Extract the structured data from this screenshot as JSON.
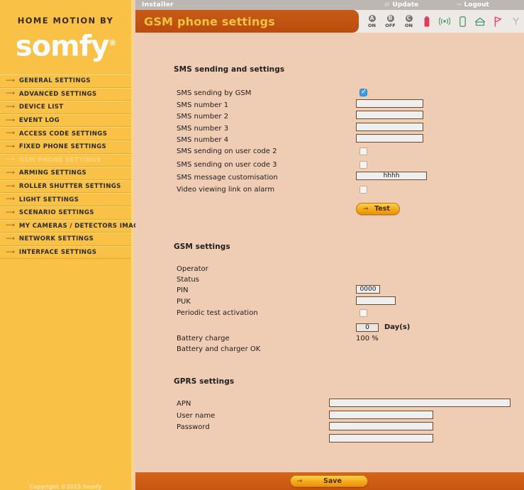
{
  "brand": {
    "tagline": "HOME MOTION BY",
    "name": "somfy",
    "registered": "®",
    "copyright": "Copyright ©2013 Somfy"
  },
  "topbar": {
    "user_role": "Installer",
    "update_label": "Update",
    "update_icon": "refresh-icon",
    "logout_label": "Logout",
    "logout_icon": "arrow-right-icon"
  },
  "header": {
    "page_title": "GSM phone settings",
    "status_groups": [
      {
        "letter": "A",
        "state": "ON"
      },
      {
        "letter": "B",
        "state": "OFF"
      },
      {
        "letter": "C",
        "state": "ON"
      }
    ],
    "status_icons": [
      {
        "name": "battery-icon",
        "color": "#E03A5C"
      },
      {
        "name": "radio-signal-icon",
        "color": "#4E9B6B"
      },
      {
        "name": "mobile-phone-icon",
        "color": "#4E9B6B"
      },
      {
        "name": "home-icon",
        "color": "#4E9B6B"
      },
      {
        "name": "flag-icon",
        "color": "#E8497A"
      },
      {
        "name": "antenna-icon",
        "color": "#B7AFA9"
      },
      {
        "name": "document-icon",
        "color": "#9A938E"
      }
    ]
  },
  "sidebar": {
    "items": [
      {
        "label": "GENERAL SETTINGS",
        "active": false
      },
      {
        "label": "ADVANCED SETTINGS",
        "active": false
      },
      {
        "label": "DEVICE LIST",
        "active": false
      },
      {
        "label": "EVENT LOG",
        "active": false
      },
      {
        "label": "ACCESS CODE SETTINGS",
        "active": false
      },
      {
        "label": "FIXED PHONE SETTINGS",
        "active": false
      },
      {
        "label": "GSM PHONE SETTINGS",
        "active": true
      },
      {
        "label": "ARMING SETTINGS",
        "active": false
      },
      {
        "label": "ROLLER SHUTTER SETTINGS",
        "active": false
      },
      {
        "label": "LIGHT SETTINGS",
        "active": false
      },
      {
        "label": "SCENARIO SETTINGS",
        "active": false
      },
      {
        "label": "MY CAMERAS / DETECTORS IMAGES",
        "active": false
      },
      {
        "label": "NETWORK SETTINGS",
        "active": false
      },
      {
        "label": "INTERFACE SETTINGS",
        "active": false
      }
    ]
  },
  "sms_section": {
    "title": "SMS sending and settings",
    "sending_by_gsm_label": "SMS sending by GSM",
    "sending_by_gsm_checked": true,
    "number1_label": "SMS number 1",
    "number1_value": "",
    "number2_label": "SMS number 2",
    "number2_value": "",
    "number3_label": "SMS number 3",
    "number3_value": "",
    "number4_label": "SMS number 4",
    "number4_value": "",
    "usercode2_label": "SMS sending on user code 2",
    "usercode2_checked": false,
    "usercode3_label": "SMS sending on user code 3",
    "usercode3_checked": false,
    "message_custom_label": "SMS message customisation",
    "message_custom_value": "hhhh",
    "video_link_label": "Video viewing link on alarm",
    "video_link_checked": false,
    "test_button_label": "Test"
  },
  "gsm_section": {
    "title": "GSM settings",
    "operator_label": "Operator",
    "operator_value": "",
    "status_label": "Status",
    "status_value": "",
    "pin_label": "PIN",
    "pin_value": "0000",
    "puk_label": "PUK",
    "puk_value": "",
    "periodic_test_label": "Periodic test activation",
    "periodic_test_checked": false,
    "days_value": "0",
    "days_unit": "Day(s)",
    "battery_charge_label": "Battery charge",
    "battery_charge_value": "100 %",
    "battery_status_label": "Battery and charger OK"
  },
  "gprs_section": {
    "title": "GPRS settings",
    "apn_label": "APN",
    "apn_value": "",
    "username_label": "User name",
    "username_value": "",
    "password_label": "Password",
    "password_value": "",
    "extra_value": ""
  },
  "footer": {
    "save_label": "Save"
  },
  "colors": {
    "sidebar_gold": "#F9C247",
    "title_orange": "#C05311",
    "title_text_gold": "#F6C243",
    "content_bg": "#EFCDB5",
    "footer_orange": "#C85511",
    "checkbox_blue": "#3E9BEE",
    "field_border": "#6B4A2E"
  }
}
